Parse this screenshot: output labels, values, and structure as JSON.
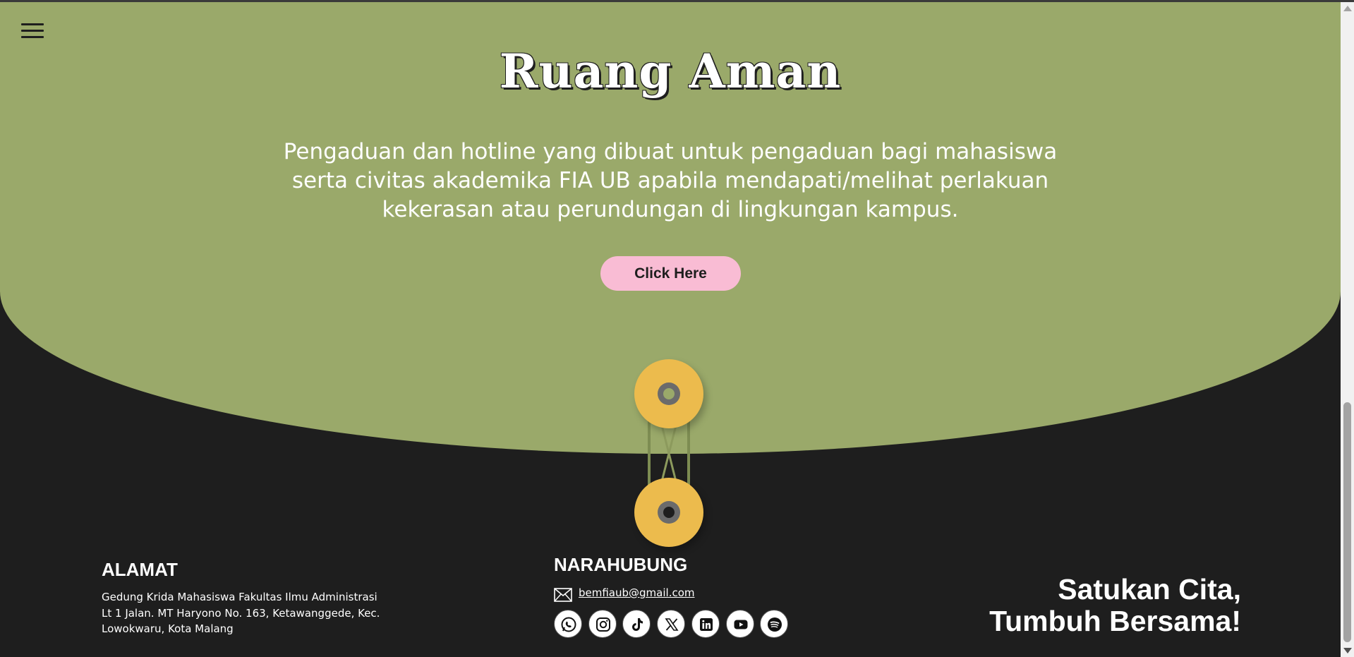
{
  "hero": {
    "title": "Ruang Aman",
    "description": "Pengaduan dan hotline yang dibuat untuk pengaduan bagi mahasiswa serta civitas akademika FIA UB apabila mendapati/melihat perlakuan kekerasan atau perundungan di lingkungan kampus.",
    "cta_label": "Click Here"
  },
  "footer": {
    "address": {
      "heading": "ALAMAT",
      "lines": [
        "Gedung Krida Mahasiswa Fakultas Ilmu Administrasi",
        "Lt 1 Jalan. MT Haryono No. 163, Ketawanggede, Kec.",
        "Lowokwaru, Kota Malang"
      ]
    },
    "contact": {
      "heading": "NARAHUBUNG",
      "email": "bemfiaub@gmail.com",
      "socials": [
        "whatsapp-icon",
        "instagram-icon",
        "tiktok-icon",
        "x-icon",
        "linkedin-icon",
        "youtube-icon",
        "spotify-icon"
      ]
    },
    "tagline": {
      "line1": "Satukan Cita,",
      "line2": "Tumbuh Bersama!"
    }
  },
  "colors": {
    "hero_bg": "#9aa96a",
    "page_bg": "#1e1e1e",
    "cta_bg": "#f9bcd4",
    "reel": "#ecbb4d"
  }
}
